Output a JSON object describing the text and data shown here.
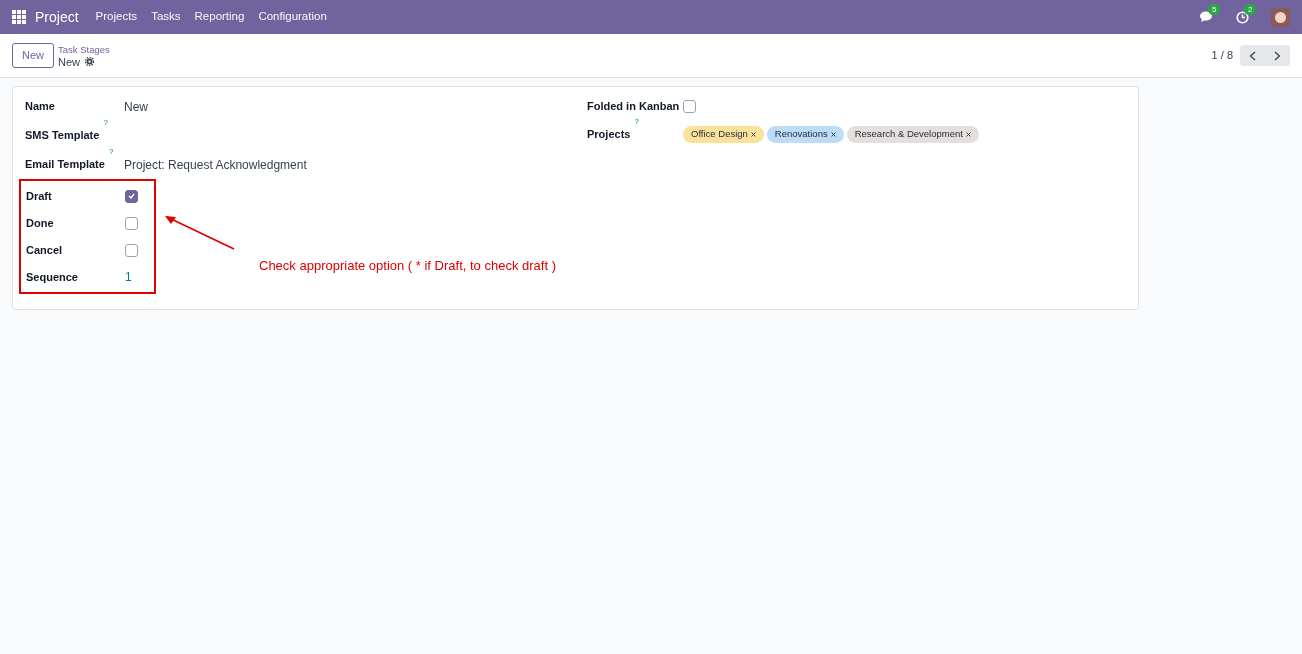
{
  "navbar": {
    "app": "Project",
    "menu": [
      "Projects",
      "Tasks",
      "Reporting",
      "Configuration"
    ],
    "messages_badge": "5",
    "activities_badge": "2"
  },
  "control_panel": {
    "new_button": "New",
    "breadcrumb": "Task Stages",
    "record": "New",
    "pager": "1 / 8"
  },
  "form": {
    "left_fields": [
      {
        "kind": "text",
        "label": "Name",
        "value": "New"
      },
      {
        "kind": "text",
        "label": "SMS Template",
        "help": "?"
      },
      {
        "kind": "text",
        "label": "Email Template",
        "help": "?",
        "value": "Project: Request Acknowledgment"
      }
    ],
    "highlighted_fields": [
      {
        "kind": "checkbox",
        "label": "Draft",
        "checked": true
      },
      {
        "kind": "checkbox",
        "label": "Done",
        "checked": false
      },
      {
        "kind": "checkbox",
        "label": "Cancel",
        "checked": false
      },
      {
        "kind": "number",
        "label": "Sequence",
        "value": "1"
      }
    ],
    "folded": {
      "label": "Folded in Kanban",
      "checked": false
    },
    "projects": {
      "label": "Projects",
      "help": "?",
      "tags": [
        {
          "label": "Office Design",
          "color": "#fbe29b"
        },
        {
          "label": "Renovations",
          "color": "#bcdcf8"
        },
        {
          "label": "Research & Development",
          "color": "#e5dedd"
        }
      ]
    }
  },
  "annotation": {
    "note": "Check appropriate option ( * if Draft, to check draft )"
  }
}
